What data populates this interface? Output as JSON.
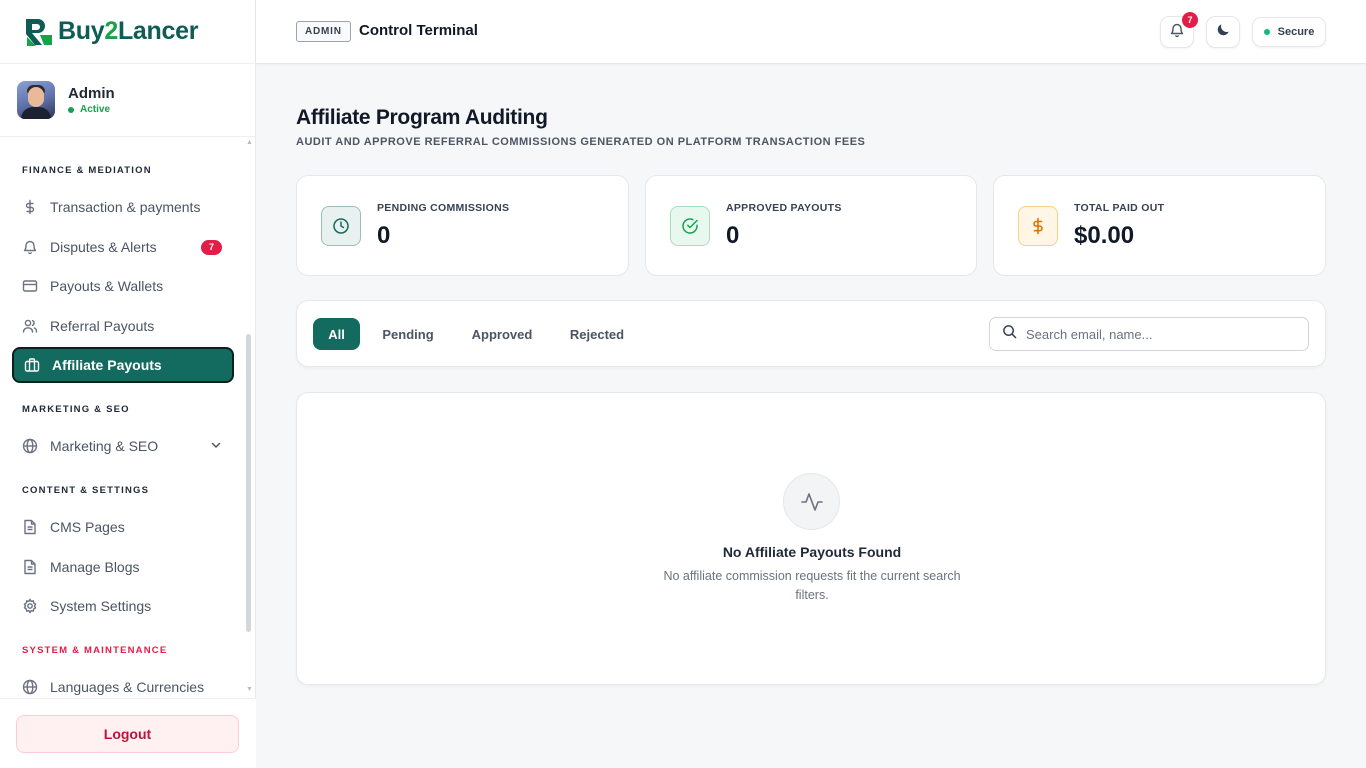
{
  "brand": {
    "name_a": "Buy",
    "name_b": "2",
    "name_c": "Lancer"
  },
  "user": {
    "name": "Admin",
    "status": "Active"
  },
  "sidebar": {
    "sections": {
      "finance": "FINANCE & MEDIATION",
      "marketing": "MARKETING & SEO",
      "content": "CONTENT & SETTINGS",
      "system": "SYSTEM & MAINTENANCE"
    },
    "items": {
      "transactions": "Transaction & payments",
      "disputes": "Disputes & Alerts",
      "disputes_badge": "7",
      "payouts": "Payouts & Wallets",
      "referral": "Referral Payouts",
      "affiliate": "Affiliate Payouts",
      "marketing": "Marketing & SEO",
      "cms": "CMS Pages",
      "blogs": "Manage Blogs",
      "settings": "System Settings",
      "languages": "Languages & Currencies"
    },
    "logout": "Logout"
  },
  "header": {
    "tag": "ADMIN",
    "title": "Control Terminal",
    "notification_count": "7",
    "secure_label": "Secure"
  },
  "page": {
    "title": "Affiliate Program Auditing",
    "subtitle": "AUDIT AND APPROVE REFERRAL COMMISSIONS GENERATED ON PLATFORM TRANSACTION FEES"
  },
  "stats": [
    {
      "label": "PENDING COMMISSIONS",
      "value": "0"
    },
    {
      "label": "APPROVED PAYOUTS",
      "value": "0"
    },
    {
      "label": "TOTAL PAID OUT",
      "value": "$0.00"
    }
  ],
  "filters": {
    "tabs": [
      "All",
      "Pending",
      "Approved",
      "Rejected"
    ],
    "search_placeholder": "Search email, name..."
  },
  "empty_state": {
    "title": "No Affiliate Payouts Found",
    "description": "No affiliate commission requests fit the current search filters."
  },
  "colors": {
    "primary": "#136b5f",
    "danger": "#e11d48",
    "success": "#16a34a"
  }
}
